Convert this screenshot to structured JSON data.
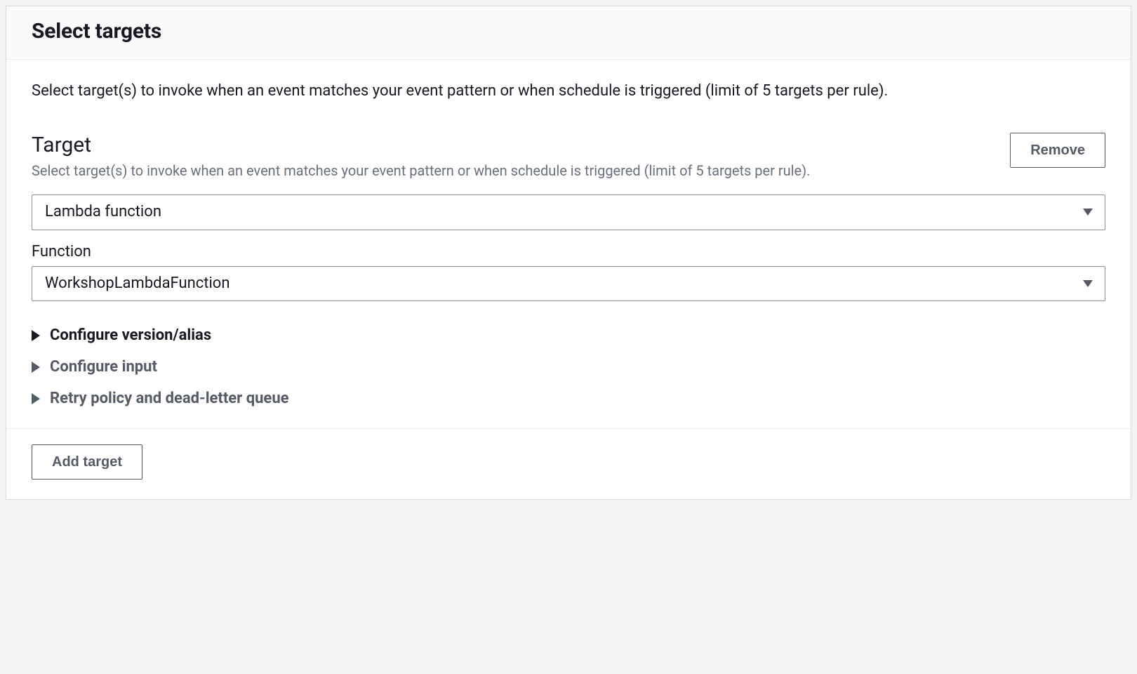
{
  "header": {
    "title": "Select targets"
  },
  "intro": "Select target(s) to invoke when an event matches your event pattern or when schedule is triggered (limit of 5 targets per rule).",
  "target": {
    "title": "Target",
    "description": "Select target(s) to invoke when an event matches your event pattern or when schedule is triggered (limit of 5 targets per rule).",
    "remove_label": "Remove",
    "type_select": {
      "value": "Lambda function"
    },
    "function_label": "Function",
    "function_select": {
      "value": "WorkshopLambdaFunction"
    },
    "expanders": [
      {
        "label": "Configure version/alias"
      },
      {
        "label": "Configure input"
      },
      {
        "label": "Retry policy and dead-letter queue"
      }
    ]
  },
  "add_target_label": "Add target"
}
